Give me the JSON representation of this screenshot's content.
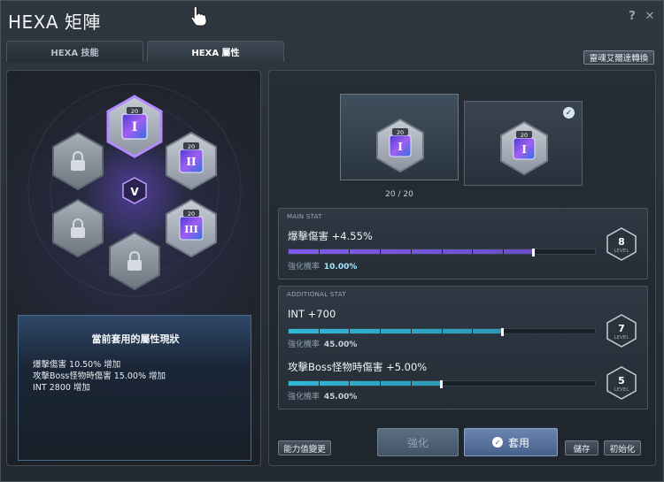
{
  "window": {
    "title": "HEXA 矩陣",
    "help_label": "?",
    "close_label": "✕"
  },
  "tabs": [
    {
      "label": "HEXA 技能",
      "active": false
    },
    {
      "label": "HEXA 屬性",
      "active": true
    }
  ],
  "convert_button": "靈魂艾爾達轉換",
  "hex_grid": {
    "center_icon": "hexa-v-icon",
    "nodes": [
      {
        "id": "top",
        "state": "active",
        "badge": "20",
        "numeral": "I"
      },
      {
        "id": "upper-right",
        "state": "unlocked",
        "badge": "20",
        "numeral": "II"
      },
      {
        "id": "lower-right",
        "state": "unlocked",
        "badge": "20",
        "numeral": "III"
      },
      {
        "id": "upper-left",
        "state": "locked"
      },
      {
        "id": "lower-left",
        "state": "locked"
      },
      {
        "id": "bottom",
        "state": "locked"
      }
    ]
  },
  "status_box": {
    "title": "當前套用的屬性現狀",
    "lines": [
      "爆擊傷害 10.50% 增加",
      "攻擊Boss怪物時傷害 15.00% 增加",
      "INT 2800 增加"
    ]
  },
  "slots": [
    {
      "badge": "20",
      "numeral": "I",
      "selected": false
    },
    {
      "badge": "20",
      "numeral": "I",
      "selected": true
    }
  ],
  "slot_count": "20 / 20",
  "main_stat": {
    "header": "MAIN STAT",
    "name": "爆擊傷害 +4.55%",
    "progress": 0.8,
    "chance_label": "強化機率",
    "chance_value": "10.00%",
    "level": "8",
    "level_label": "LEVEL",
    "color": "#7f5af0"
  },
  "additional_stat": {
    "header": "ADDITIONAL STAT",
    "stats": [
      {
        "name": "INT +700",
        "progress": 0.7,
        "chance_label": "強化機率",
        "chance_value": "45.00%",
        "level": "7",
        "level_label": "LEVEL"
      },
      {
        "name": "攻擊Boss怪物時傷害 +5.00%",
        "progress": 0.5,
        "chance_label": "強化機率",
        "chance_value": "45.00%",
        "level": "5",
        "level_label": "LEVEL"
      }
    ],
    "color": "#2fb8d8"
  },
  "buttons": {
    "change_ability": "能力值變更",
    "enhance": "強化",
    "apply": "套用",
    "save": "儲存",
    "reset": "初始化"
  },
  "colors": {
    "accent_purple": "#8a5cf6",
    "accent_cyan": "#35c3e6",
    "locked_hex": "#8a929c"
  }
}
